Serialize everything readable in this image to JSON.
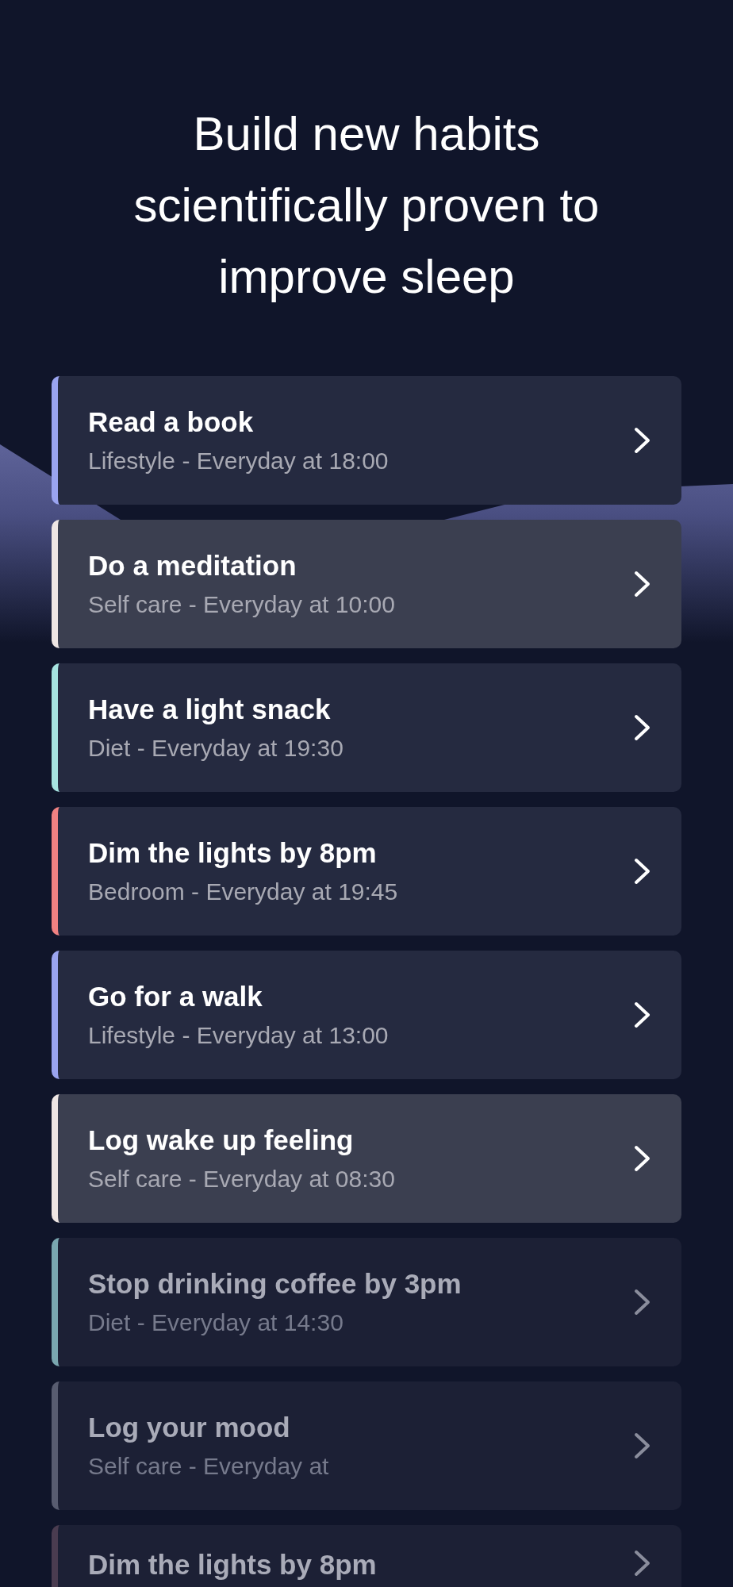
{
  "heading": "Build new habits scientifically proven to improve sleep",
  "habits": [
    {
      "title": "Read a book",
      "subtitle": "Lifestyle - Everyday at 18:00",
      "color": "#9aa4f0",
      "highlighted": false,
      "faded": false
    },
    {
      "title": "Do a meditation",
      "subtitle": "Self care - Everyday at 10:00",
      "color": "#efe6e4",
      "highlighted": true,
      "faded": false
    },
    {
      "title": "Have a light snack",
      "subtitle": "Diet - Everyday at 19:30",
      "color": "#a6e3e0",
      "highlighted": false,
      "faded": false
    },
    {
      "title": "Dim the lights by 8pm",
      "subtitle": "Bedroom - Everyday at 19:45",
      "color": "#f08282",
      "highlighted": false,
      "faded": false
    },
    {
      "title": "Go for a walk",
      "subtitle": "Lifestyle - Everyday at 13:00",
      "color": "#9aa4f0",
      "highlighted": false,
      "faded": false
    },
    {
      "title": "Log wake up feeling",
      "subtitle": "Self care - Everyday at 08:30",
      "color": "#efe6e4",
      "highlighted": true,
      "faded": false
    },
    {
      "title": "Stop drinking coffee by 3pm",
      "subtitle": "Diet - Everyday at 14:30",
      "color": "#7aa7b0",
      "highlighted": false,
      "faded": true
    },
    {
      "title": "Log your mood",
      "subtitle": "Self care - Everyday at",
      "color": "#585c70",
      "highlighted": false,
      "faded": true
    },
    {
      "title": "Dim the lights by 8pm",
      "color": "#4a3c50",
      "highlighted": false,
      "faded": true
    }
  ]
}
